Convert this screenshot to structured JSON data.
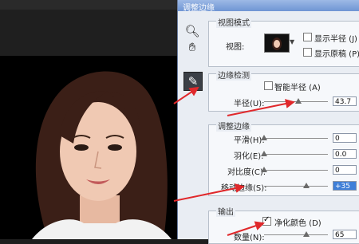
{
  "dialog": {
    "title": "调整边缘",
    "view_mode": {
      "title": "视图模式",
      "view_label": "视图:",
      "show_radius": "显示半径 (J)",
      "show_original": "显示原稿 (P)"
    },
    "edge_detection": {
      "title": "边缘检测",
      "smart_radius": "智能半径 (A)",
      "radius_label": "半径(U):",
      "radius_value": "43.7",
      "radius_slider_fraction": 0.55
    },
    "adjust_edge": {
      "title": "调整边缘",
      "rows": [
        {
          "label": "平滑(H):",
          "value": "0",
          "fraction": 0.0
        },
        {
          "label": "羽化(E):",
          "value": "0.0",
          "fraction": 0.0
        },
        {
          "label": "对比度(C):",
          "value": "0",
          "fraction": 0.0
        },
        {
          "label": "移动边缘(S):",
          "value": "+35",
          "fraction": 0.67
        }
      ]
    },
    "output": {
      "title": "输出",
      "decontaminate": "净化颜色 (D)",
      "decontaminate_checked": true,
      "amount_label": "数量(N):",
      "amount_value": "65"
    }
  },
  "tools": {
    "zoom": "magnifier-icon",
    "hand": "hand-icon",
    "refine_brush": "refine-radius-brush-icon"
  },
  "colors": {
    "annotation_arrow": "#e0282b",
    "selected_field": "#3f7fd8"
  }
}
